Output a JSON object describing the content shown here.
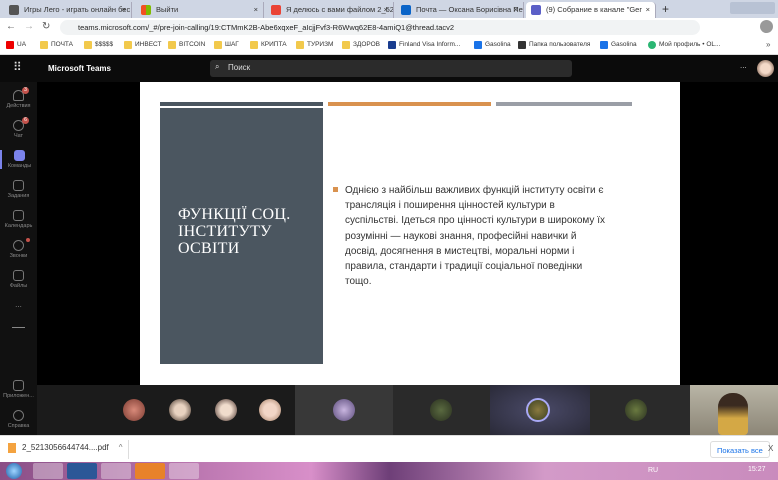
{
  "browser": {
    "tabs": [
      {
        "label": "Игры Лего - играть онлайн бес"
      },
      {
        "label": "Выйти"
      },
      {
        "label": "Я делюсь с вами файлом 2_521"
      },
      {
        "label": "Почта — Оксана Борисівна Пет"
      },
      {
        "label": "(9) Собрание в канале \"Ger"
      }
    ],
    "new_tab": "+",
    "url": "teams.microsoft.com/_#/pre-join-calling/19:CTMmK2B-Abe6xqxeF_aIcjjFvf3-R6Wwq62E8-4amiQ1@thread.tacv2",
    "bookmarks": [
      "UA",
      "ПОЧТА",
      "$$$$$",
      "ИНВЕСТ",
      "BITCOIN",
      "ШАГ",
      "КРИПТА",
      "ТУРИЗМ",
      "ЗДОРОВ",
      "Finland Visa Inform...",
      "Gasolina",
      "Папка пользователя",
      "Gasolina",
      "Мой профиль • OL..."
    ],
    "more": "»"
  },
  "teams": {
    "app_name": "Microsoft Teams",
    "search_placeholder": "Поиск",
    "more": "...",
    "sidebar": [
      {
        "label": "Действия",
        "badge": "3"
      },
      {
        "label": "Чат",
        "badge": "6"
      },
      {
        "label": "Команды"
      },
      {
        "label": "Задания"
      },
      {
        "label": "Календарь"
      },
      {
        "label": "Звонки"
      },
      {
        "label": "Файлы"
      },
      {
        "label": "..."
      },
      {
        "label": "Приложен..."
      },
      {
        "label": "Справка"
      }
    ]
  },
  "slide": {
    "title": "ФУНКЦІЇ СОЦ. ІНСТИТУТУ ОСВІТИ",
    "lines": [
      "Однією з найбільш важливих функцій інституту освіти є",
      "трансляція і поширення цінностей культури в",
      "суспільстві. Ідеться про цінності культури в широкому їх",
      "розумінні — наукові знання, професійні навички й",
      "досвід, досягнення в мистецтві, моральні норми і",
      "правила, стандарти і традиції соціальної поведінки",
      "тощо."
    ],
    "colors": {
      "panel": "#4b5660",
      "accent": "#d9924f",
      "bar_gray": "#9a9ea6"
    }
  },
  "download": {
    "file": "2_5213056644744....pdf",
    "show_all": "Показать все",
    "close": "X"
  },
  "taskbar": {
    "lang": "RU",
    "time": "15:27"
  }
}
